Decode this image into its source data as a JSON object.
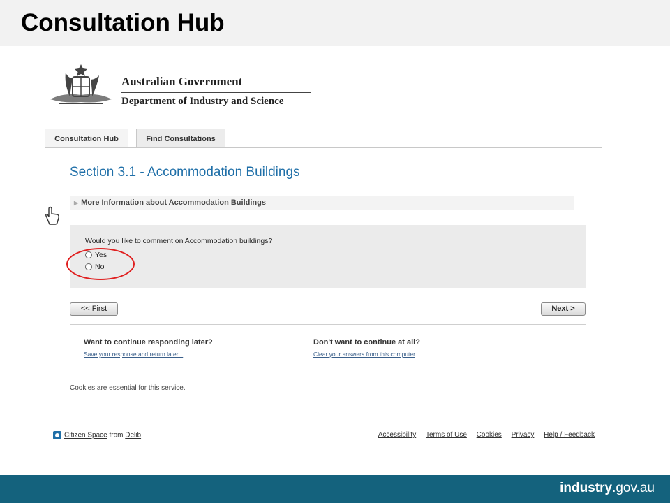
{
  "slide": {
    "title": "Consultation Hub"
  },
  "branding": {
    "government": "Australian Government",
    "department": "Department of Industry and Science"
  },
  "tabs": [
    {
      "label": "Consultation Hub"
    },
    {
      "label": "Find Consultations"
    }
  ],
  "section": {
    "title": "Section 3.1 - Accommodation Buildings"
  },
  "more_info": {
    "label": "More Information about Accommodation Buildings"
  },
  "question": {
    "text": "Would you like to comment on Accommodation buildings?",
    "options": [
      {
        "label": "Yes"
      },
      {
        "label": "No"
      }
    ]
  },
  "nav": {
    "first_label": "<< First",
    "next_label": "Next >"
  },
  "save_panel": {
    "continue_later_q": "Want to continue responding later?",
    "continue_later_link": "Save your response and return later...",
    "stop_q": "Don't want to continue at all?",
    "stop_link": "Clear your answers from this computer"
  },
  "cookies_note": "Cookies are essential for this service.",
  "footer": {
    "citizen_space": "Citizen Space",
    "from_text": "from",
    "delib": "Delib",
    "links": [
      "Accessibility",
      "Terms of Use",
      "Cookies",
      "Privacy",
      "Help / Feedback"
    ]
  },
  "brand": {
    "bold": "industry",
    "rest": ".gov.au"
  },
  "colors": {
    "section_title": "#1f6fa8",
    "bottom_bar": "#14627d",
    "highlight": "#e02020"
  }
}
